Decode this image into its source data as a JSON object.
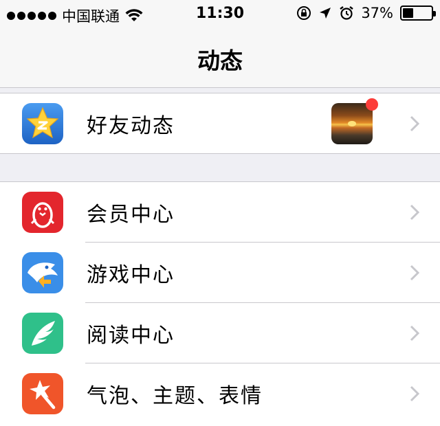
{
  "status_bar": {
    "carrier": "中国联通",
    "time": "11:30",
    "battery_percent": "37%",
    "battery_level": 0.37,
    "icons": [
      "signal-dots-icon",
      "wifi-icon",
      "orientation-lock-icon",
      "location-arrow-icon",
      "alarm-icon",
      "battery-icon"
    ]
  },
  "nav": {
    "title": "动态"
  },
  "groups": [
    {
      "items": [
        {
          "label": "好友动态",
          "icon": "qzone-star-icon",
          "has_thumbnail": true,
          "badge": "red-dot"
        }
      ]
    },
    {
      "items": [
        {
          "label": "会员中心",
          "icon": "penguin-icon"
        },
        {
          "label": "游戏中心",
          "icon": "game-shark-icon"
        },
        {
          "label": "阅读中心",
          "icon": "feather-book-icon"
        },
        {
          "label": "气泡、主题、表情",
          "icon": "magic-wand-star-icon"
        }
      ]
    }
  ],
  "colors": {
    "background": "#efeff4",
    "separator": "#c8c7cc",
    "chevron": "#c7c7cc",
    "badge": "#fc3d39",
    "qzone_blue": "#2f7bd9",
    "vip_red": "#e3262d",
    "game_blue": "#3a8ee8",
    "read_green": "#2fc08a",
    "theme_orange": "#f0552a"
  }
}
